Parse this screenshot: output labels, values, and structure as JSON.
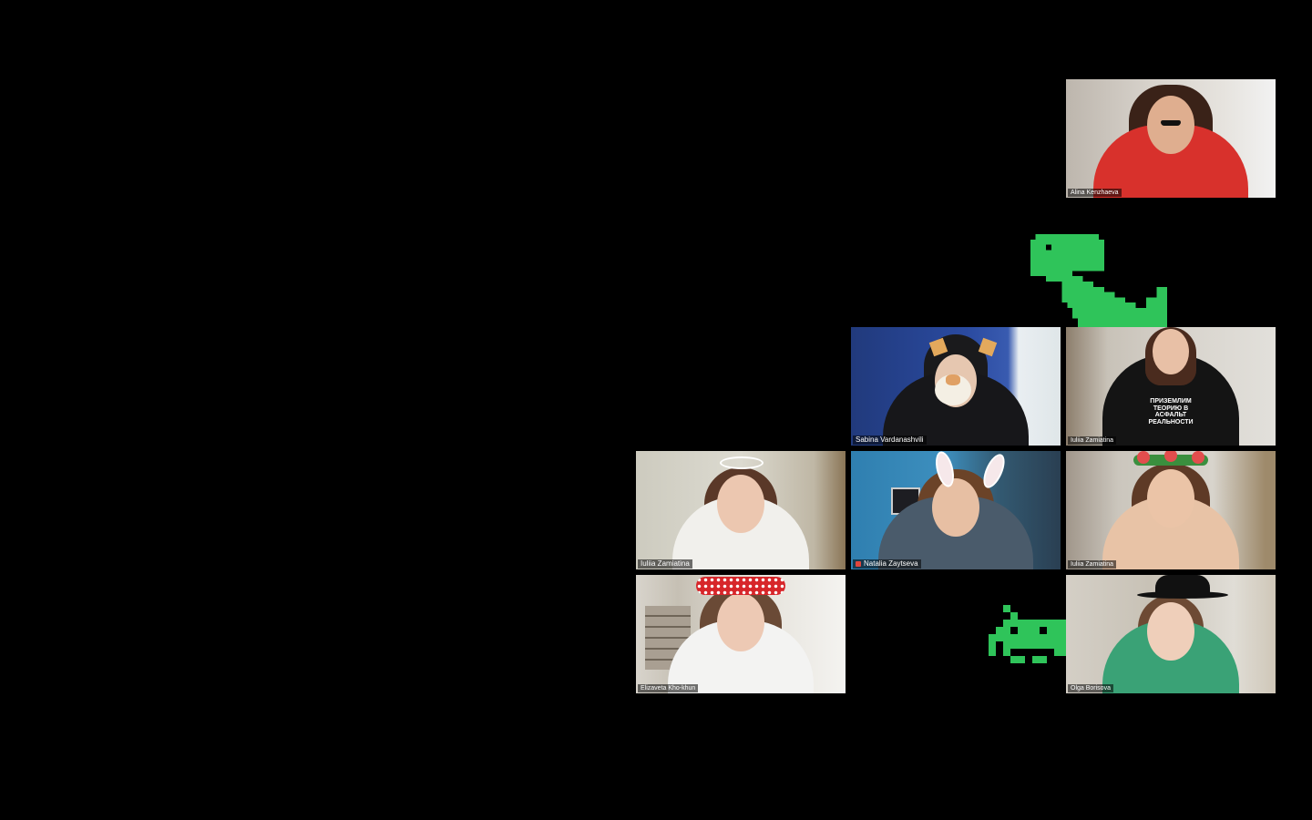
{
  "meeting": {
    "participants": [
      {
        "name": "Alina Kenzhaeva"
      },
      {
        "name": "Sabina Vardanashvili"
      },
      {
        "name": "Iuliia Zamiatina",
        "shirt_text": "ПРИЗЕМЛИМ ТЕОРИЮ В АСФАЛЬТ РЕАЛЬНОСТИ"
      },
      {
        "name": "Iuliia Zamiatina"
      },
      {
        "name": "Natalia Zaytseva",
        "muted": true
      },
      {
        "name": "Iuliia Zamiatina"
      },
      {
        "name": "Elizaveta Kho-khun"
      },
      {
        "name": "Olga Borisova"
      }
    ],
    "decorations": [
      {
        "icon": "pixel-dinosaur-icon",
        "color": "#2fc45a"
      },
      {
        "icon": "pixel-space-invader-icon",
        "color": "#2fc45a"
      }
    ]
  },
  "colors": {
    "background": "#000000",
    "accent_green": "#2fc45a",
    "muted_red": "#e0463c"
  }
}
